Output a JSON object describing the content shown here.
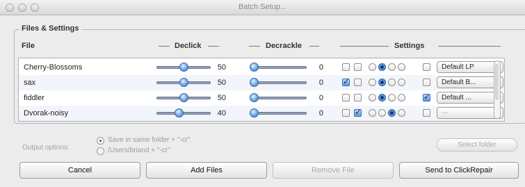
{
  "window": {
    "title": "Batch Setup..."
  },
  "group": {
    "title": "Files & Settings",
    "columns": {
      "file": "File",
      "declick": "Declick",
      "decrackle": "Decrackle",
      "settings": "Settings"
    }
  },
  "rows": [
    {
      "file": "Cherry-Blossoms",
      "declick": 50,
      "decrackle": 0,
      "declick_level": 0.5,
      "decrackle_level": 0.0,
      "check1": false,
      "check2": false,
      "radio_selected": 2,
      "check3": false,
      "preset": "Default LP"
    },
    {
      "file": "sax",
      "declick": 50,
      "decrackle": 0,
      "declick_level": 0.5,
      "decrackle_level": 0.0,
      "check1": true,
      "check2": false,
      "radio_selected": 2,
      "check3": false,
      "preset": "Default B..."
    },
    {
      "file": "fiddler",
      "declick": 50,
      "decrackle": 0,
      "declick_level": 0.5,
      "decrackle_level": 0.0,
      "check1": false,
      "check2": false,
      "radio_selected": 2,
      "check3": true,
      "preset": "Default ..."
    },
    {
      "file": "Dvorak-noisy",
      "declick": 40,
      "decrackle": 0,
      "declick_level": 0.4,
      "decrackle_level": 0.0,
      "check1": false,
      "check2": true,
      "radio_selected": 3,
      "check3": false,
      "preset": "---"
    }
  ],
  "output": {
    "label": "Output options:",
    "option_same": "Save in same folder + \"-cr\"",
    "option_path": "/Users/briand + \"-cr\"",
    "selected": "same",
    "select_folder": "Select folder"
  },
  "buttons": {
    "cancel": "Cancel",
    "add_files": "Add Files",
    "remove_file": "Remove File",
    "send": "Send to ClickRepair"
  },
  "colors": {
    "accent": "#3b78cc",
    "window_bg": "#ececec"
  }
}
